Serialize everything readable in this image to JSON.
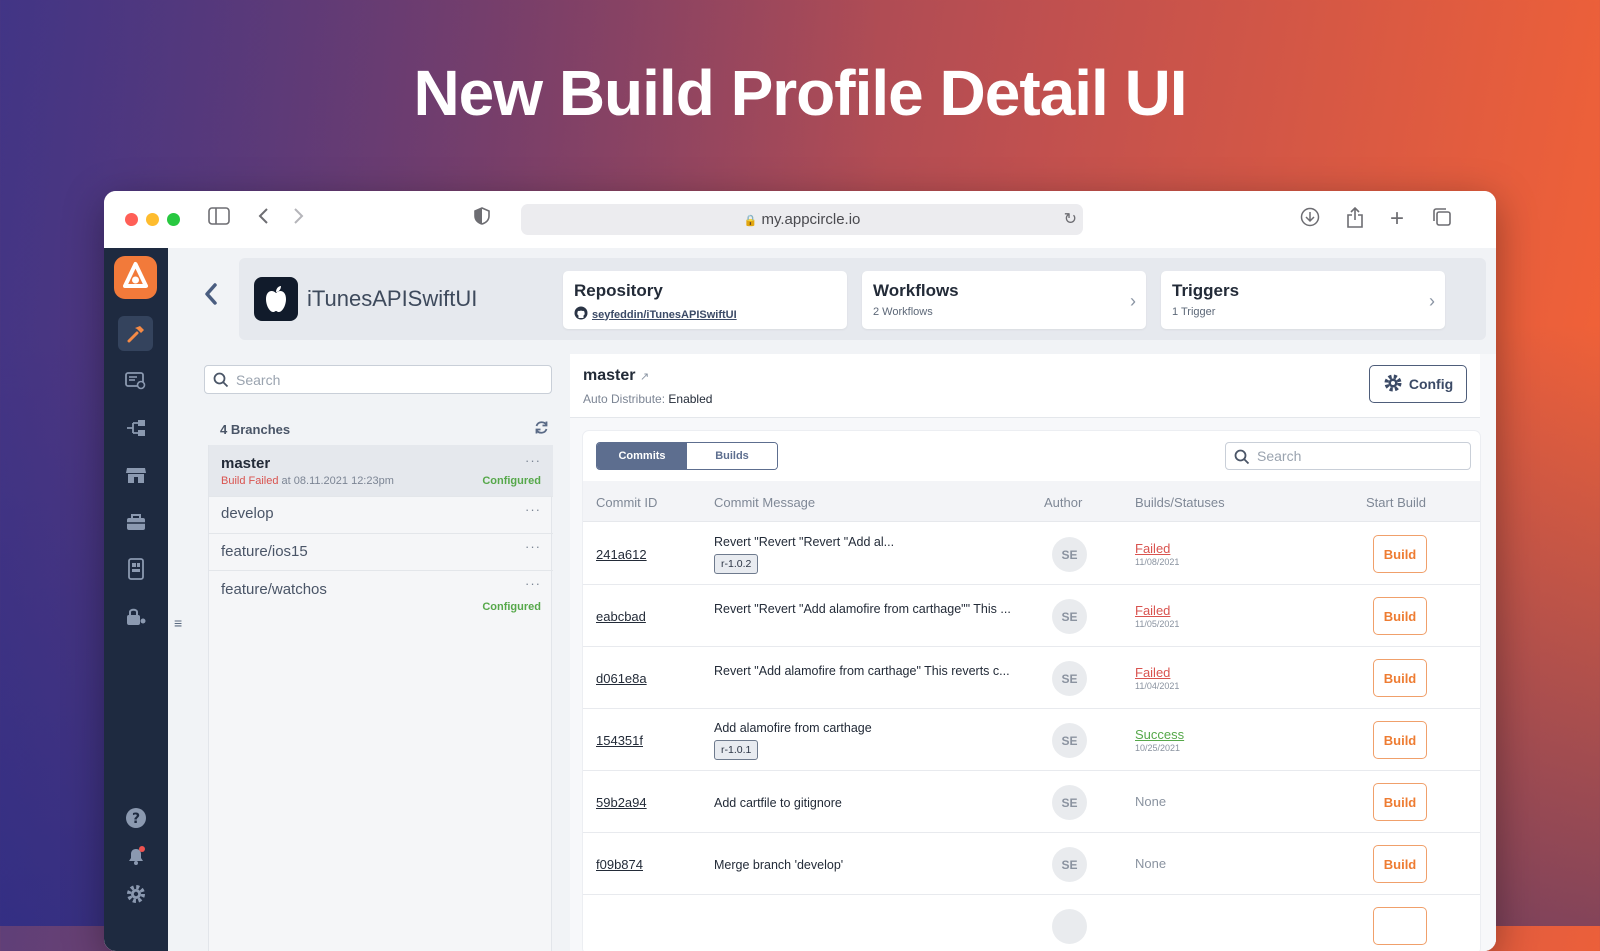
{
  "hero_title": "New Build Profile Detail UI",
  "browser": {
    "url": "my.appcircle.io",
    "colors": {
      "close": "#ff5f57",
      "minimize": "#febc2e",
      "zoom": "#28c840"
    }
  },
  "header": {
    "app_name": "iTunesAPISwiftUI",
    "repository": {
      "title": "Repository",
      "link": "seyfeddin/iTunesAPISwiftUI"
    },
    "workflows": {
      "title": "Workflows",
      "sub": "2 Workflows"
    },
    "triggers": {
      "title": "Triggers",
      "sub": "1 Trigger"
    }
  },
  "branches": {
    "search_placeholder": "Search",
    "count_label": "4 Branches",
    "items": [
      {
        "name": "master",
        "status": "Build Failed",
        "status_suffix": "at 08.11.2021 12:23pm",
        "badge": "Configured"
      },
      {
        "name": "develop",
        "badge": ""
      },
      {
        "name": "feature/ios15",
        "badge": ""
      },
      {
        "name": "feature/watchos",
        "badge": "Configured"
      }
    ]
  },
  "main": {
    "branch_name": "master",
    "auto_distribute_label": "Auto Distribute:",
    "auto_distribute_value": "Enabled",
    "config_label": "Config",
    "tabs": [
      "Commits",
      "Builds"
    ],
    "search_placeholder": "Search",
    "columns": [
      "Commit ID",
      "Commit Message",
      "Author",
      "Builds/Statuses",
      "Start Build"
    ],
    "commits": [
      {
        "id": "241a612",
        "message": "Revert \"Revert \"Revert \"Add al...",
        "tag": "r-1.0.2",
        "author": "SE",
        "status": "Failed",
        "date": "11/08/2021",
        "build": "Build"
      },
      {
        "id": "eabcbad",
        "message": "Revert \"Revert \"Add alamofire from carthage\"\" This ...",
        "tag": "",
        "author": "SE",
        "status": "Failed",
        "date": "11/05/2021",
        "build": "Build"
      },
      {
        "id": "d061e8a",
        "message": "Revert \"Add alamofire from carthage\" This reverts c...",
        "tag": "",
        "author": "SE",
        "status": "Failed",
        "date": "11/04/2021",
        "build": "Build"
      },
      {
        "id": "154351f",
        "message": "Add alamofire from carthage",
        "tag": "r-1.0.1",
        "author": "SE",
        "status": "Success",
        "date": "10/25/2021",
        "build": "Build"
      },
      {
        "id": "59b2a94",
        "message": "Add cartfile to gitignore",
        "tag": "",
        "author": "SE",
        "status": "None",
        "date": "",
        "build": "Build"
      },
      {
        "id": "f09b874",
        "message": "Merge branch 'develop'",
        "tag": "",
        "author": "SE",
        "status": "None",
        "date": "",
        "build": "Build"
      }
    ]
  },
  "colors": {
    "accent": "#ee7c32",
    "failed": "#d9534f",
    "success": "#56a84a",
    "sidebar": "#1e2a40",
    "configured": "#56a84a"
  },
  "icons": {
    "nav": [
      "hammer-icon",
      "certificate-icon",
      "distribution-icon",
      "store-icon",
      "toolbox-icon",
      "testing-device-icon",
      "lock-user-icon"
    ],
    "nav_bottom": [
      "help-icon",
      "bell-icon",
      "gear-icon"
    ]
  }
}
